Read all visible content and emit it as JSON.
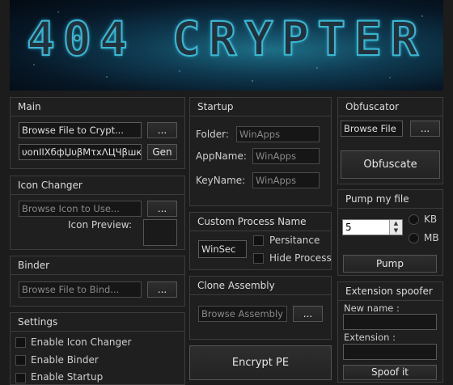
{
  "banner": {
    "title": "404 CRYPTER"
  },
  "main": {
    "title": "Main",
    "file_field": "Browse File to Crypt...",
    "browse_label": "...",
    "key_field": "υonIIXбфЏυβMτxΛЦЧβшк",
    "gen_label": "Gen"
  },
  "icon_changer": {
    "title": "Icon Changer",
    "icon_field": "Browse Icon to Use...",
    "browse_label": "...",
    "preview_label": "Icon Preview:"
  },
  "binder": {
    "title": "Binder",
    "file_field": "Browse File to Bind...",
    "browse_label": "..."
  },
  "settings": {
    "title": "Settings",
    "options": [
      "Enable Icon Changer",
      "Enable Binder",
      "Enable Startup"
    ]
  },
  "startup": {
    "title": "Startup",
    "folder_label": "Folder:",
    "folder_value": "WinApps",
    "appname_label": "AppName:",
    "appname_value": "WinApps",
    "keyname_label": "KeyName:",
    "keyname_value": "WinApps"
  },
  "custom_process": {
    "title": "Custom Process Name",
    "name_value": "WinSec",
    "persistance_label": "Persitance",
    "hide_label": "Hide Process"
  },
  "clone_assembly": {
    "title": "Clone Assembly",
    "field": "Browse Assembly",
    "browse_label": "..."
  },
  "encrypt": {
    "label": "Encrypt PE"
  },
  "obfuscator": {
    "title": "Obfuscator",
    "field": "Browse File",
    "browse_label": "...",
    "button": "Obfuscate"
  },
  "pump": {
    "title": "Pump my file",
    "value": "5",
    "kb_label": "KB",
    "mb_label": "MB",
    "button": "Pump"
  },
  "extension_spoofer": {
    "title": "Extension spoofer",
    "new_name_label": "New name :",
    "extension_label": "Extension :",
    "button": "Spoof it"
  }
}
